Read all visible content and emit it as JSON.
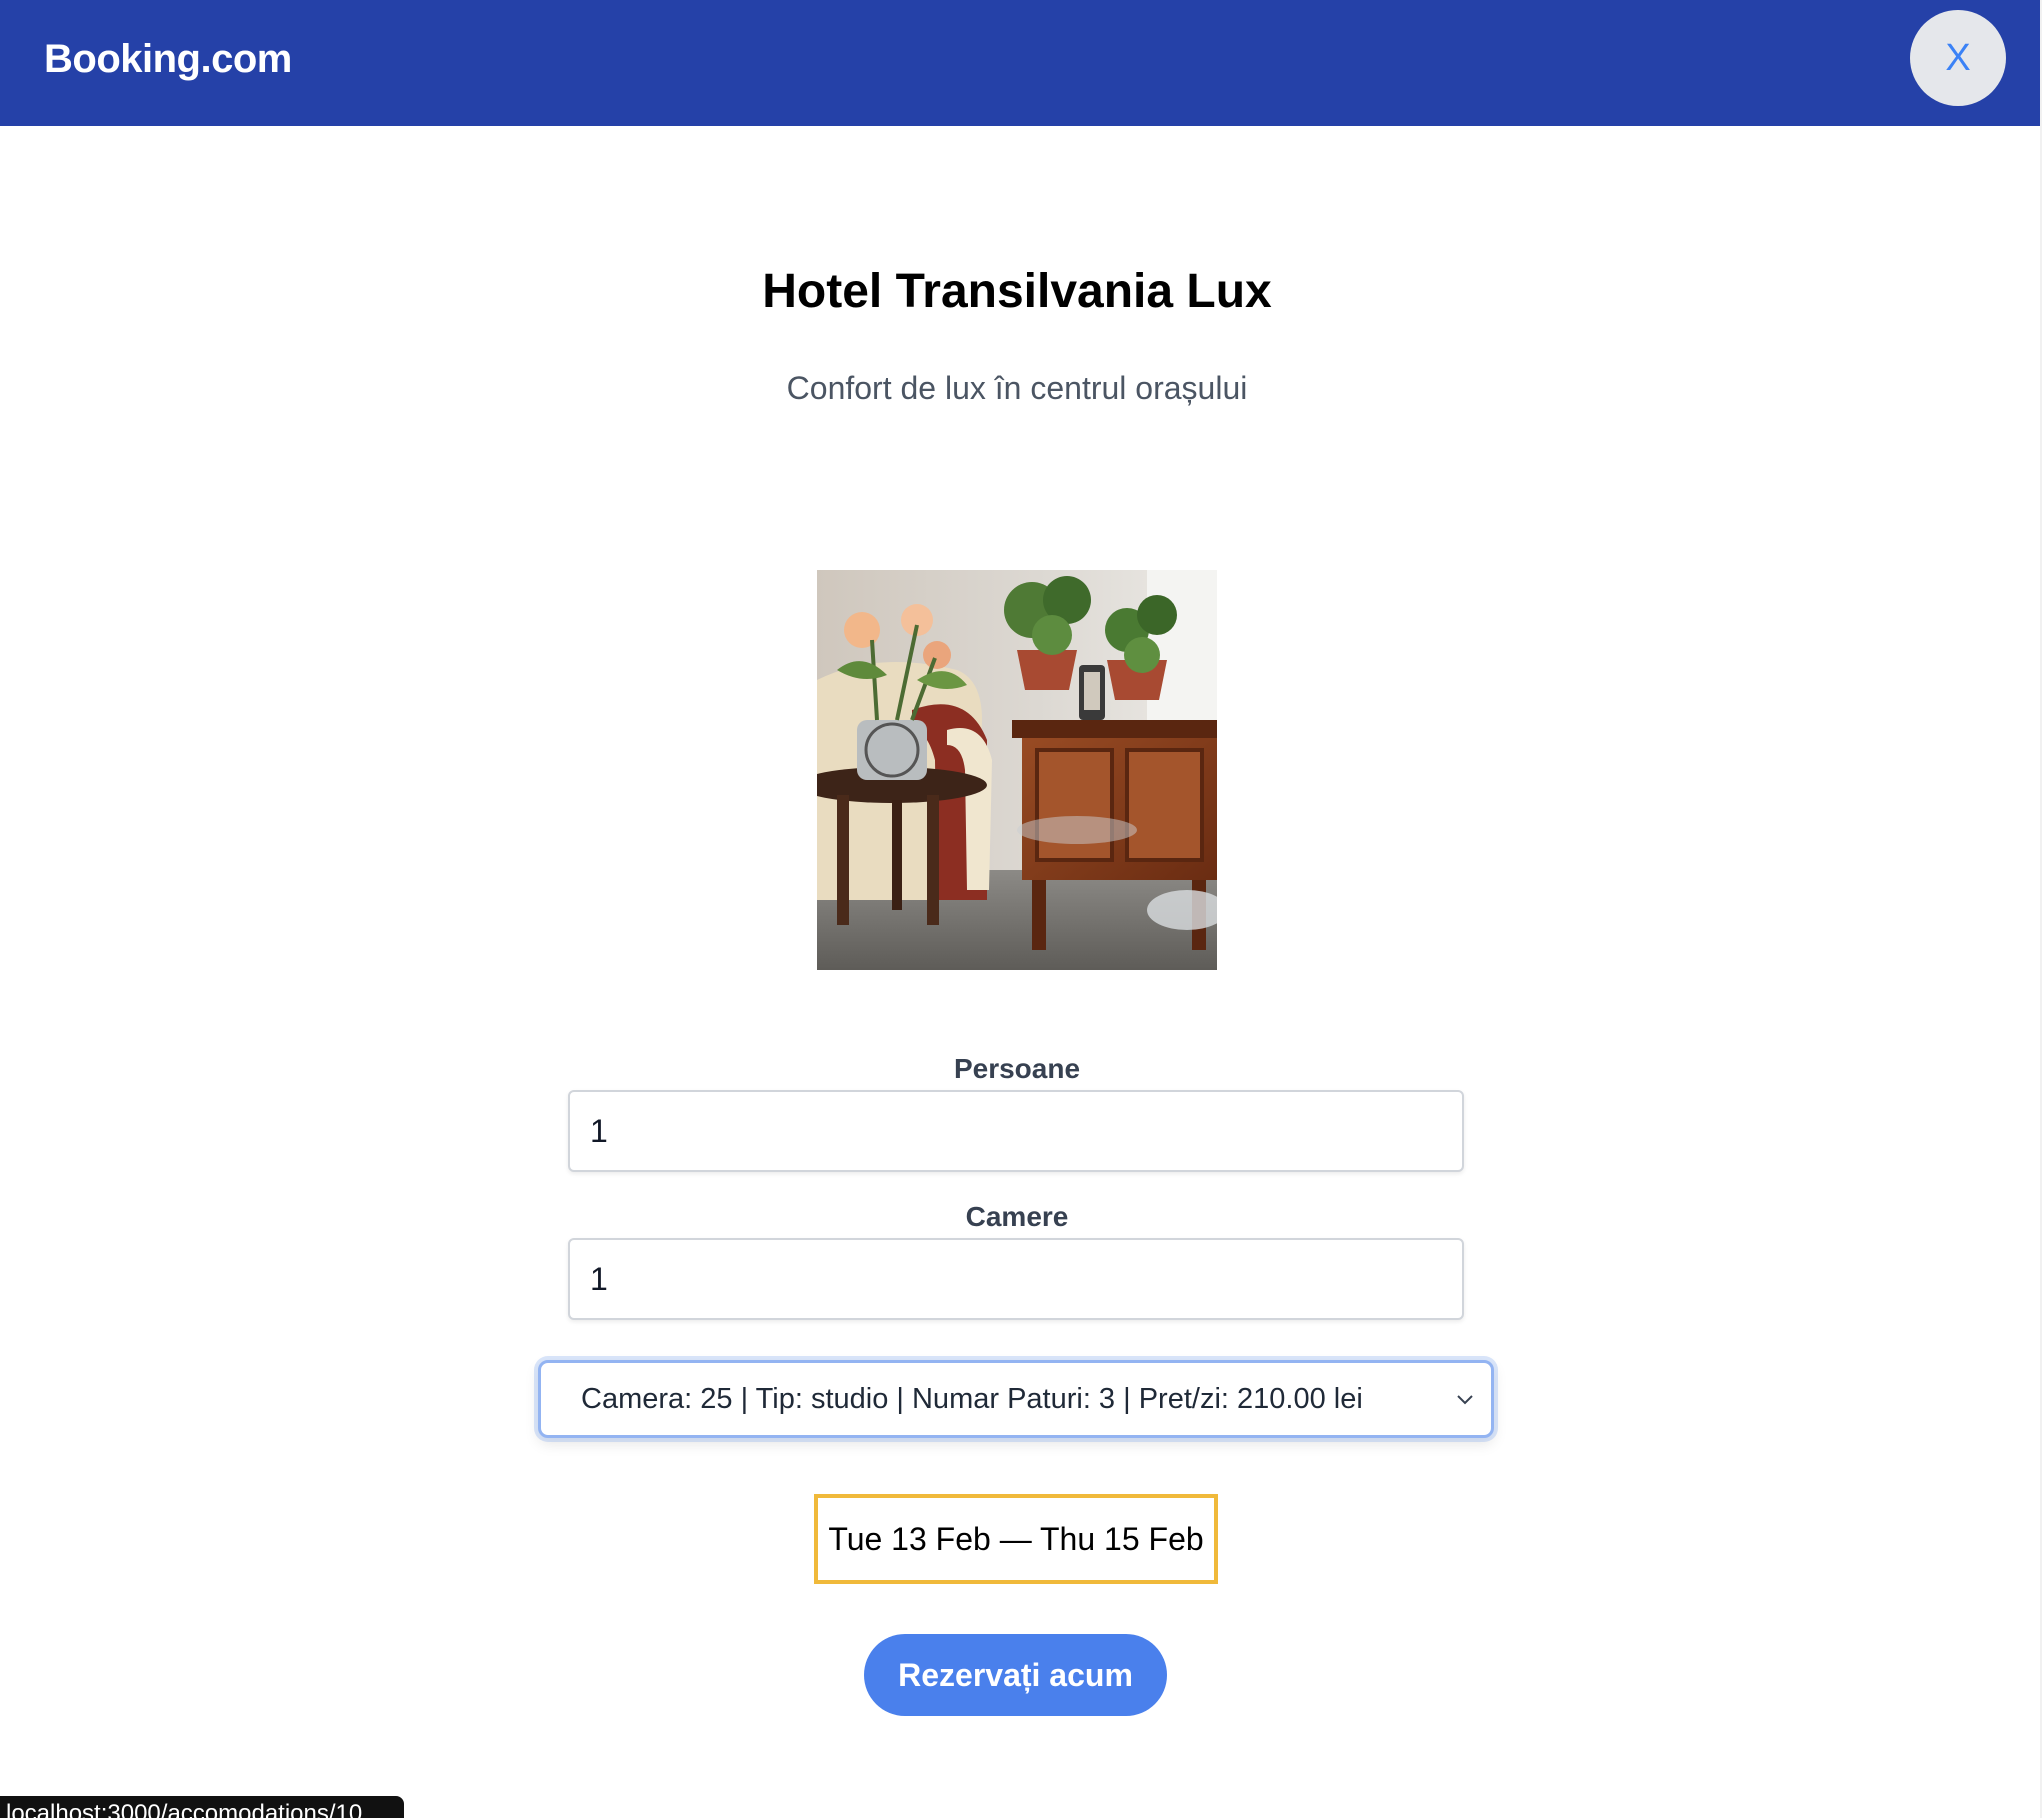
{
  "header": {
    "brand": "Booking.com",
    "close_label": "X",
    "background_color": "#2541a8"
  },
  "hotel": {
    "name": "Hotel Transilvania Lux",
    "tagline": "Confort de lux în centrul orașului"
  },
  "form": {
    "persons": {
      "label": "Persoane",
      "value": "1"
    },
    "rooms": {
      "label": "Camere",
      "value": "1"
    },
    "room_select": {
      "selected": "Camera: 25 | Tip: studio | Numar Paturi: 3 | Pret/zi: 210.00 lei",
      "icon": "chevron-down-icon"
    },
    "date_range": "Tue 13 Feb — Thu 15 Feb",
    "submit_label": "Rezervați acum"
  },
  "status_bar": {
    "url": "localhost:3000/accomodations/10"
  },
  "colors": {
    "accent": "#4a80ec",
    "date_border": "#f0b93a",
    "focus_ring": "#93b4f2"
  }
}
